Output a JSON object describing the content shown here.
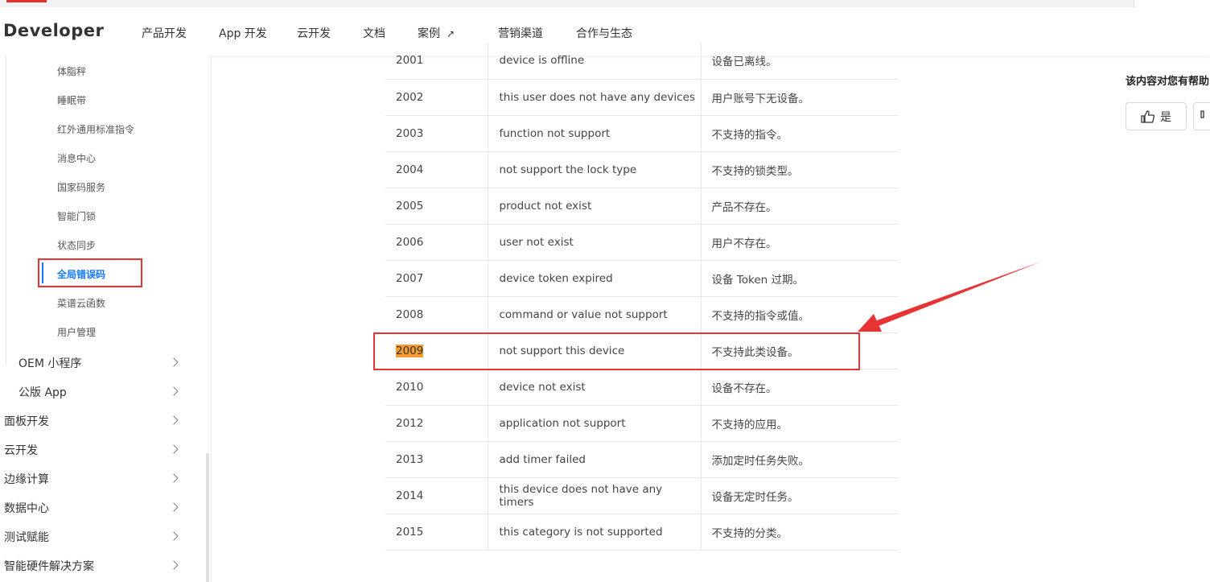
{
  "header": {
    "logo": "Developer",
    "nav": [
      "产品开发",
      "App 开发",
      "云开发",
      "文档",
      "案例",
      "营销渠道",
      "合作与生态"
    ],
    "case_ext_icon": "external-link-icon"
  },
  "sidebar": {
    "sub_items": [
      "体脂秤",
      "睡眠带",
      "红外通用标准指令",
      "消息中心",
      "国家码服务",
      "智能门锁",
      "状态同步",
      "全局错误码",
      "菜谱云函数",
      "用户管理"
    ],
    "active_index": 7,
    "groups": [
      "OEM 小程序",
      "公版 App"
    ],
    "sections": [
      "面板开发",
      "云开发",
      "边缘计算",
      "数据中心",
      "测试赋能",
      "智能硬件解决方案"
    ]
  },
  "table": {
    "rows": [
      [
        "2001",
        "device is offline",
        "设备已离线。"
      ],
      [
        "2002",
        "this user does not have any devices",
        "用户账号下无设备。"
      ],
      [
        "2003",
        "function not support",
        "不支持的指令。"
      ],
      [
        "2004",
        "not support the lock type",
        "不支持的锁类型。"
      ],
      [
        "2005",
        "product not exist",
        "产品不存在。"
      ],
      [
        "2006",
        "user not exist",
        "用户不存在。"
      ],
      [
        "2007",
        "device token expired",
        "设备 Token 过期。"
      ],
      [
        "2008",
        "command or value not support",
        "不支持的指令或值。"
      ],
      [
        "2009",
        "not support this device",
        "不支持此类设备。"
      ],
      [
        "2010",
        "device not exist",
        "设备不存在。"
      ],
      [
        "2012",
        "application not support",
        "不支持的应用。"
      ],
      [
        "2013",
        "add timer failed",
        "添加定时任务失败。"
      ],
      [
        "2014",
        "this device does not have any timers",
        "设备无定时任务。"
      ],
      [
        "2015",
        "this category is not supported",
        "不支持的分类。"
      ]
    ],
    "highlight_code": "2009",
    "annotation_color": "#e63434"
  },
  "feedback": {
    "title": "该内容对您有帮助",
    "yes_label": "是",
    "yes_icon": "thumbs-up-icon",
    "no_icon": "thumbs-down-icon"
  }
}
